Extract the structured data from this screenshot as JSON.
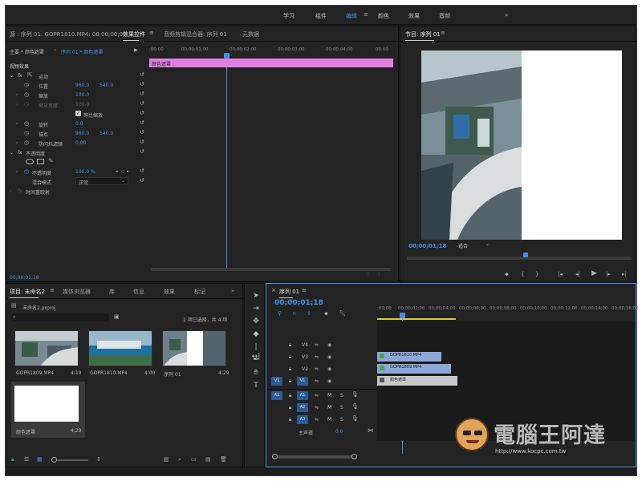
{
  "workspaces": [
    "学习",
    "组件",
    "编辑",
    "颜色",
    "效果",
    "音频"
  ],
  "workspace_active": "编辑",
  "workspace_more": "»",
  "effect_controls": {
    "source_label": "源 : 序列 01: GOPR1810.MP4: 00;00;00;00",
    "tab_effect_controls": "效果控件",
    "tab_audio_mixer": "音频剪辑混合器: 序列 01",
    "tab_metadata": "元数据",
    "clip_selector": "主要 * 颜色遮罩",
    "clip_path": "序列 01 * 颜色遮罩",
    "ruler_ticks": [
      ";00;00",
      "00;00;01;00",
      "00;00;02;00",
      "00;00;03;00",
      "00;00;04;00",
      "00;00"
    ],
    "clip_bar_label": "颜色遮罩",
    "section_video_effects": "视频效果",
    "motion": "运动",
    "position": "位置",
    "position_x": "960.0",
    "position_y": "540.0",
    "scale": "缩放",
    "scale_val": "100.0",
    "scale_width": "缩放宽度",
    "scale_width_val": "100.0",
    "uniform_scale": "等比缩放",
    "rotation": "旋转",
    "rotation_val": "0.0",
    "anchor": "锚点",
    "anchor_x": "960.0",
    "anchor_y": "540.0",
    "anti_flicker": "防闪烁滤镜",
    "anti_flicker_val": "0.00",
    "opacity_section": "不透明度",
    "opacity": "不透明度",
    "opacity_val": "100.0 %",
    "blend_mode": "混合模式",
    "blend_mode_val": "正常",
    "time_remap": "时间重映射",
    "timecode": "00;00;01;18"
  },
  "program": {
    "title": "节目: 序列 01",
    "timecode": "00;00;01;18",
    "fit": "适合"
  },
  "project": {
    "tab_project": "项目: 未命名2",
    "tab_media_browser": "媒体浏览器",
    "tab_library": "库",
    "tab_info": "信息",
    "tab_effects": "效果",
    "tab_markers": "标记",
    "file_name": "未命名2.prproj",
    "selection_info": "1 项已选择，共 4 项",
    "items": [
      {
        "name": "GOPR1809.MP4",
        "duration": "4;19"
      },
      {
        "name": "GOPR1810.MP4",
        "duration": "4;00"
      },
      {
        "name": "序列 01",
        "duration": "4;29"
      },
      {
        "name": "颜色遮罩",
        "duration": "4;29"
      }
    ]
  },
  "timeline": {
    "title": "序列 01",
    "timecode": "00;00;01;18",
    "ruler": [
      ";00;00",
      "00;00;02;00",
      "00;00;04;00",
      "00;00;06;00",
      "00;00;08;00",
      "00;00;10;00",
      "00;00;12;00",
      "00;00;14;00",
      "00;00;16;00"
    ],
    "video_tracks": [
      "V4",
      "V3",
      "V2",
      "V1"
    ],
    "source_v1": "V1",
    "audio_tracks": [
      "A1",
      "A2",
      "A3"
    ],
    "source_a1": "A1",
    "master": "主声道",
    "master_val": "0.0",
    "m": "M",
    "s": "S",
    "clips": [
      {
        "label": "GOPR1810.MP4",
        "color": "#8fa7d8"
      },
      {
        "label": "GOPR1809.MP4",
        "color": "#8fa7d8"
      },
      {
        "label": "颜色遮罩",
        "color": "#c9c9c9"
      }
    ]
  },
  "watermark": {
    "text": "電腦王阿達",
    "url": "http://www.kocpc.com.tw"
  },
  "colors": {
    "accent": "#4a8de8",
    "clip_pink": "#e07fe0",
    "clip_blue": "#8fa7d8"
  }
}
